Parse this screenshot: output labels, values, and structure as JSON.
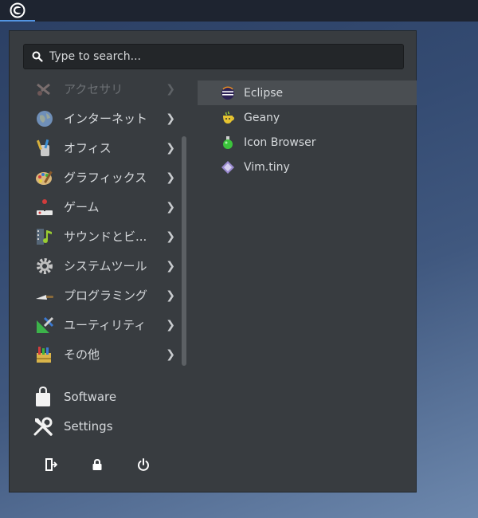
{
  "search": {
    "placeholder": "Type to search..."
  },
  "categories": [
    {
      "label": "アクセサリ",
      "icon": "accessories-icon",
      "disabled": true
    },
    {
      "label": "インターネット",
      "icon": "globe-icon"
    },
    {
      "label": "オフィス",
      "icon": "office-icon"
    },
    {
      "label": "グラフィックス",
      "icon": "palette-icon"
    },
    {
      "label": "ゲーム",
      "icon": "joystick-icon"
    },
    {
      "label": "サウンドとビ...",
      "icon": "multimedia-icon"
    },
    {
      "label": "システムツール",
      "icon": "gear-icon"
    },
    {
      "label": "プログラミング",
      "icon": "trowel-icon"
    },
    {
      "label": "ユーティリティ",
      "icon": "utilities-icon"
    },
    {
      "label": "その他",
      "icon": "other-icon"
    }
  ],
  "apps": [
    {
      "label": "Eclipse",
      "icon": "eclipse-icon",
      "active": true
    },
    {
      "label": "Geany",
      "icon": "geany-icon"
    },
    {
      "label": "Icon Browser",
      "icon": "flask-icon"
    },
    {
      "label": "Vim.tiny",
      "icon": "vim-icon"
    }
  ],
  "places": [
    {
      "label": "Software",
      "icon": "shopping-bag-icon"
    },
    {
      "label": "Settings",
      "icon": "wrench-screwdriver-icon"
    }
  ],
  "session": [
    {
      "icon": "logout-icon"
    },
    {
      "icon": "lock-icon"
    },
    {
      "icon": "power-icon"
    }
  ],
  "colors": {
    "panel": "#383c40",
    "topbar": "#1e2430",
    "accent": "#5294e2",
    "highlight": "#4a4e52"
  }
}
